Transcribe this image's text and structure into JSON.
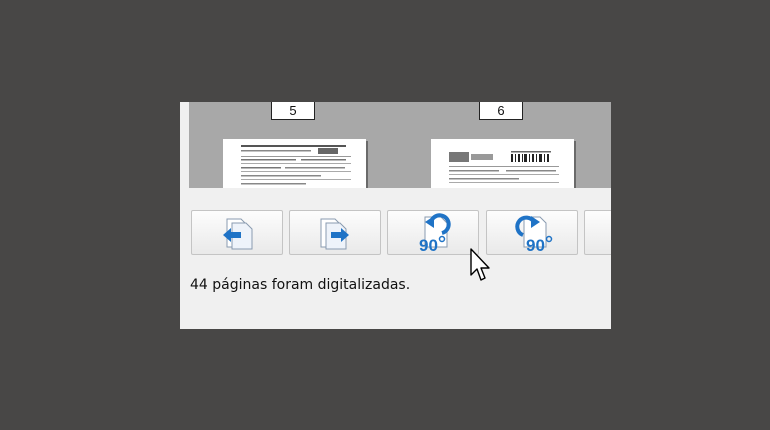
{
  "thumbnails": [
    {
      "page_number": "5"
    },
    {
      "page_number": "6"
    }
  ],
  "toolbar": {
    "buttons": [
      {
        "icon": "move-page-left-icon"
      },
      {
        "icon": "move-page-right-icon"
      },
      {
        "icon": "rotate-left-90-icon",
        "label": "90"
      },
      {
        "icon": "rotate-right-90-icon",
        "label": "90"
      },
      {
        "icon": "more-button"
      }
    ]
  },
  "status": {
    "text": "44 páginas foram digitalizadas."
  },
  "colors": {
    "desktop": "#484746",
    "panel": "#f0f0f0",
    "thumb_area": "#a8a8a8",
    "icon_blue": "#1f73c6"
  }
}
